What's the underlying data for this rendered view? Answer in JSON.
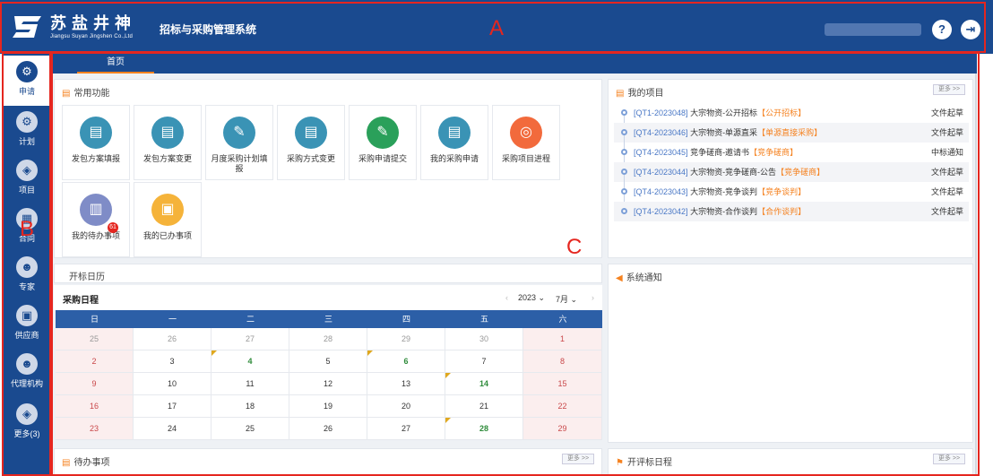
{
  "header": {
    "logo_cn": "苏盐井神",
    "logo_en": "Jiangsu Suyan Jingshen Co.,Ltd",
    "system_title": "招标与采购管理系统",
    "help_label": "?",
    "logout_label": "⇥"
  },
  "annotations": {
    "a": "A",
    "b": "B",
    "c": "C"
  },
  "sidebar": {
    "items": [
      {
        "label": "申请",
        "icon": "gear-icon",
        "glyph": "⚙"
      },
      {
        "label": "计划",
        "icon": "gear-icon",
        "glyph": "⚙"
      },
      {
        "label": "项目",
        "icon": "layers-icon",
        "glyph": "◈"
      },
      {
        "label": "合同",
        "icon": "grid-icon",
        "glyph": "▦"
      },
      {
        "label": "专家",
        "icon": "users-icon",
        "glyph": "☻"
      },
      {
        "label": "供应商",
        "icon": "store-icon",
        "glyph": "▣"
      },
      {
        "label": "代理机构",
        "icon": "users-icon",
        "glyph": "☻"
      },
      {
        "label": "更多(3)",
        "icon": "layers-icon",
        "glyph": "◈"
      }
    ]
  },
  "tabs": {
    "home": "首页"
  },
  "quick_functions": {
    "title": "常用功能",
    "items": [
      {
        "label": "发包方案填报",
        "color": "#3a93b5",
        "glyph": "▤"
      },
      {
        "label": "发包方案变更",
        "color": "#3a93b5",
        "glyph": "▤"
      },
      {
        "label": "月度采购计划填报",
        "color": "#3a93b5",
        "glyph": "✎"
      },
      {
        "label": "采购方式变更",
        "color": "#3a93b5",
        "glyph": "▤"
      },
      {
        "label": "采购申请提交",
        "color": "#2aa05a",
        "glyph": "✎"
      },
      {
        "label": "我的采购申请",
        "color": "#3a93b5",
        "glyph": "▤"
      },
      {
        "label": "采购项目进程",
        "color": "#f26a3c",
        "glyph": "◎"
      },
      {
        "label": "我的待办事项",
        "color": "#7f8cc7",
        "glyph": "▥",
        "badge": "61"
      },
      {
        "label": "我的已办事项",
        "color": "#f5b33a",
        "glyph": "▣"
      }
    ]
  },
  "projects": {
    "title": "我的项目",
    "more": "更多 >>",
    "items": [
      {
        "code": "[QT1-2023048]",
        "name": "大宗物资-公开招标",
        "tag": "【公开招标】",
        "status": "文件起草"
      },
      {
        "code": "[QT4-2023046]",
        "name": "大宗物资-单源直采",
        "tag": "【单源直接采购】",
        "status": "文件起草"
      },
      {
        "code": "[QT4-2023045]",
        "name": "竞争磋商-邀请书",
        "tag": "【竞争磋商】",
        "status": "中标通知"
      },
      {
        "code": "[QT4-2023044]",
        "name": "大宗物资-竞争磋商-公告",
        "tag": "【竞争磋商】",
        "status": "文件起草"
      },
      {
        "code": "[QT4-2023043]",
        "name": "大宗物资-竞争谈判",
        "tag": "【竞争谈判】",
        "status": "文件起草"
      },
      {
        "code": "[QT4-2023042]",
        "name": "大宗物资-合作谈判",
        "tag": "【合作谈判】",
        "status": "文件起草"
      }
    ]
  },
  "calendar": {
    "panel_title": "开标日历",
    "sub_title": "采购日程",
    "year": "2023",
    "month": "7月",
    "weekdays": [
      "日",
      "一",
      "二",
      "三",
      "四",
      "五",
      "六"
    ],
    "weeks": [
      [
        "25",
        "26",
        "27",
        "28",
        "29",
        "30",
        "1"
      ],
      [
        "2",
        "3",
        "4",
        "5",
        "6",
        "7",
        "8"
      ],
      [
        "9",
        "10",
        "11",
        "12",
        "13",
        "14",
        "15"
      ],
      [
        "16",
        "17",
        "18",
        "19",
        "20",
        "21",
        "22"
      ],
      [
        "23",
        "24",
        "25",
        "26",
        "27",
        "28",
        "29"
      ]
    ],
    "event_days": [
      "4",
      "6",
      "14",
      "28"
    ]
  },
  "notices": {
    "title": "系统通知"
  },
  "todo": {
    "title": "待办事项",
    "more": "更多 >>"
  },
  "bid_schedule": {
    "title": "开评标日程",
    "more": "更多 >>"
  }
}
